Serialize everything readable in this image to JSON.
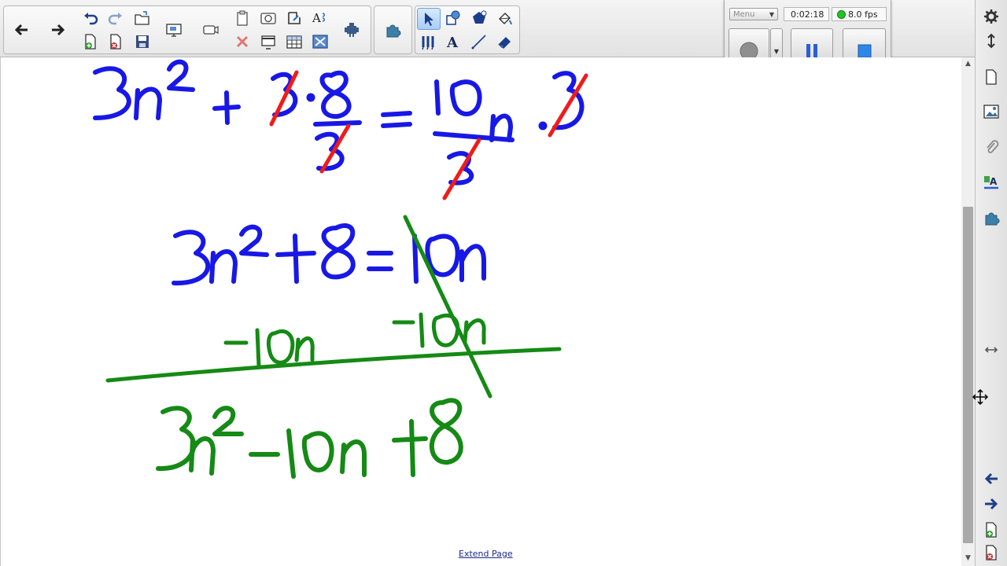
{
  "toolbar": {
    "buttons": [
      {
        "name": "previous-page",
        "icon": "arrow-left-icon"
      },
      {
        "name": "next-page",
        "icon": "arrow-right-icon"
      },
      {
        "name": "undo",
        "icon": "undo-icon"
      },
      {
        "name": "redo",
        "icon": "redo-icon"
      },
      {
        "name": "open-file",
        "icon": "folder-open-icon"
      },
      {
        "name": "add-page",
        "icon": "add-page-icon"
      },
      {
        "name": "delete-page",
        "icon": "delete-page-icon"
      },
      {
        "name": "save",
        "icon": "save-icon"
      },
      {
        "name": "screen-shade",
        "icon": "monitor-icon"
      },
      {
        "name": "camera",
        "icon": "camera-icon"
      },
      {
        "name": "paste",
        "icon": "paste-icon"
      },
      {
        "name": "screen-capture",
        "icon": "screen-capture-icon"
      },
      {
        "name": "clear",
        "icon": "clear-icon"
      },
      {
        "name": "full-screen",
        "icon": "full-screen-icon"
      },
      {
        "name": "delete",
        "icon": "delete-x-icon"
      },
      {
        "name": "table",
        "icon": "table-icon"
      },
      {
        "name": "hide-screen",
        "icon": "hide-icon"
      },
      {
        "name": "document-camera",
        "icon": "document-camera-icon"
      },
      {
        "name": "add-ons",
        "icon": "puzzle-icon"
      },
      {
        "name": "select",
        "icon": "cursor-icon"
      },
      {
        "name": "shapes",
        "icon": "shapes-icon"
      },
      {
        "name": "fill",
        "icon": "paint-bucket-icon"
      },
      {
        "name": "pens",
        "icon": "pens-icon"
      },
      {
        "name": "text",
        "icon": "text-icon"
      },
      {
        "name": "lines",
        "icon": "line-icon"
      },
      {
        "name": "eraser",
        "icon": "eraser-icon"
      }
    ]
  },
  "recorder": {
    "menu_label": "Menu",
    "elapsed_time": "0:02:18",
    "fps_label": "8.0 fps",
    "status_color": "#22c322"
  },
  "sidebar": {
    "icons": [
      "page-icon",
      "gallery-icon",
      "attachment-icon",
      "properties-icon",
      "puzzle-icon",
      "resize-icon",
      "arrow-left-icon",
      "arrow-right-icon",
      "add-page-icon",
      "delete-page-icon"
    ]
  },
  "canvas": {
    "extend_link": "Extend Page",
    "ink_colors": {
      "blue": "#1818e6",
      "red": "#ee1c1c",
      "green": "#158a15"
    }
  }
}
